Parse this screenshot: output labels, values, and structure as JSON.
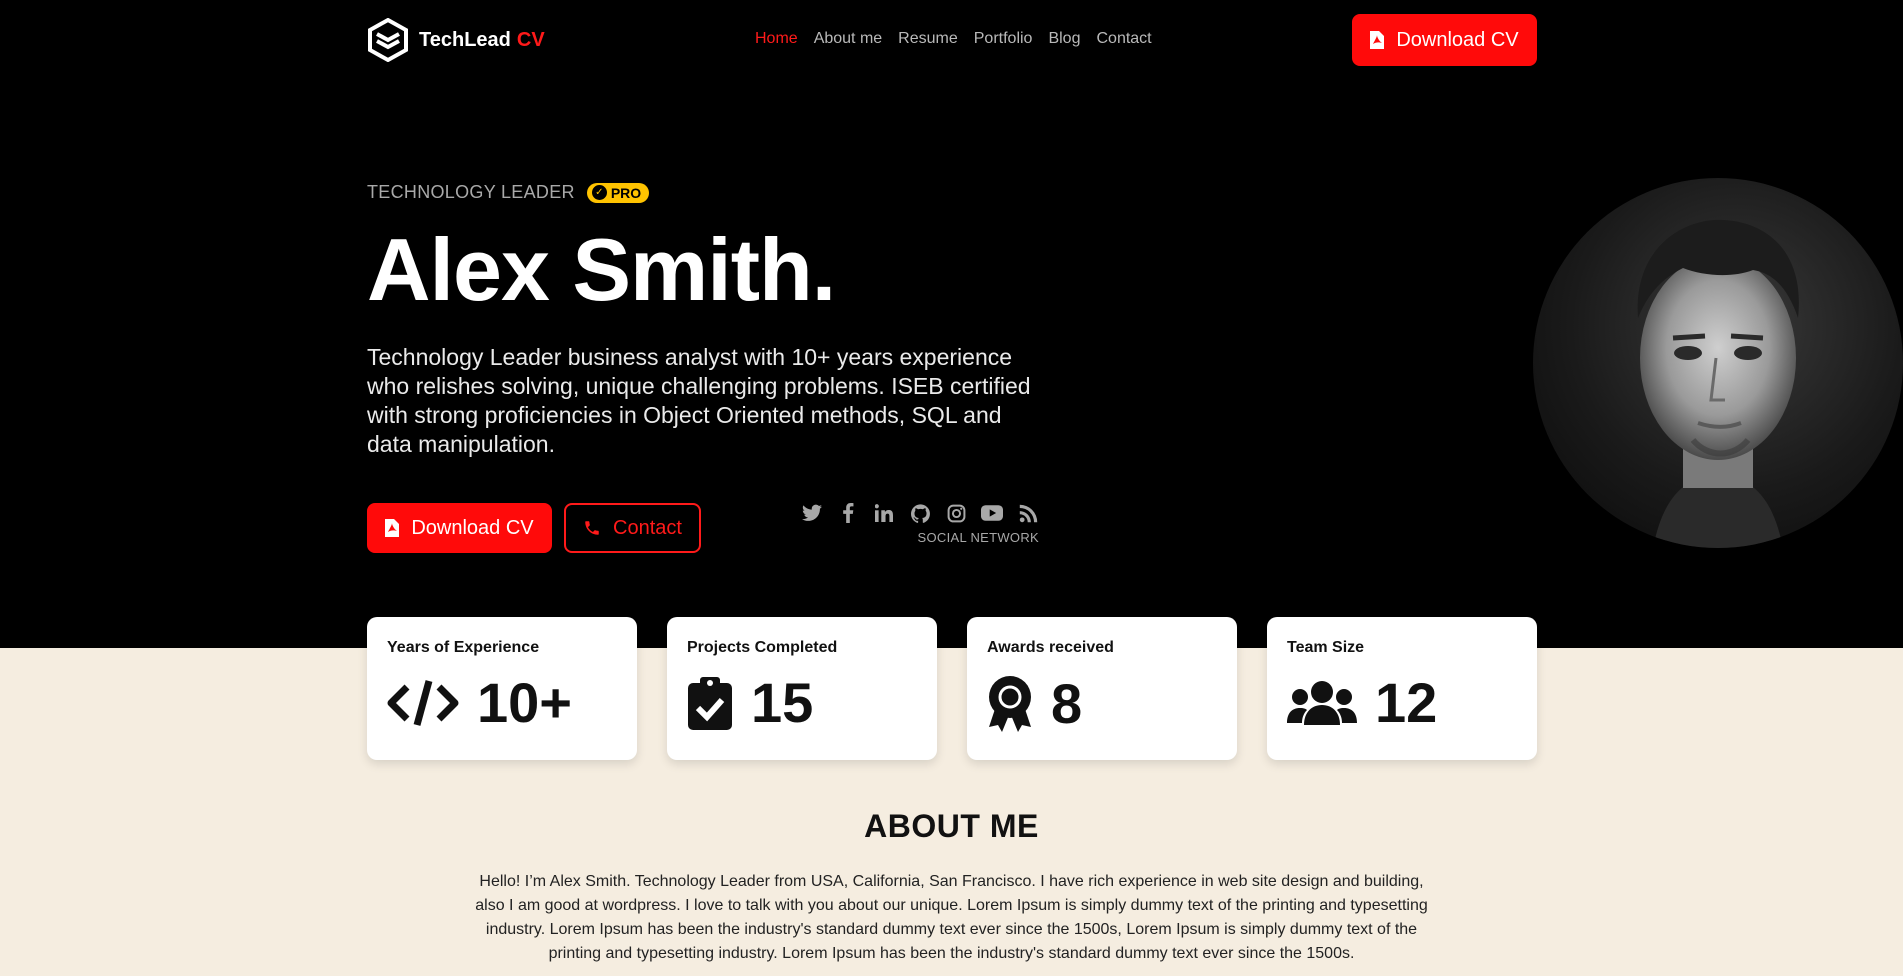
{
  "header": {
    "logo_text": "TechLead",
    "logo_accent": "CV",
    "nav": [
      {
        "label": "Home",
        "active": true
      },
      {
        "label": "About me",
        "active": false
      },
      {
        "label": "Resume",
        "active": false
      },
      {
        "label": "Portfolio",
        "active": false
      },
      {
        "label": "Blog",
        "active": false
      },
      {
        "label": "Contact",
        "active": false
      }
    ],
    "download_label": "Download CV"
  },
  "hero": {
    "eyebrow": "TECHNOLOGY LEADER",
    "badge": "PRO",
    "name": "Alex Smith.",
    "bio": "Technology Leader business analyst with 10+ years experience who relishes solving, unique challenging problems. ISEB certified with strong proficiencies in Object Oriented methods, SQL and data manipulation.",
    "download_label": "Download CV",
    "contact_label": "Contact",
    "social_label": "SOCIAL NETWORK",
    "social_icons": [
      "twitter-icon",
      "facebook-icon",
      "linkedin-icon",
      "github-icon",
      "instagram-icon",
      "youtube-icon",
      "rss-icon"
    ]
  },
  "stats": [
    {
      "title": "Years of Experience",
      "value": "10+",
      "icon": "code-icon"
    },
    {
      "title": "Projects Completed",
      "value": "15",
      "icon": "clipboard-check-icon"
    },
    {
      "title": "Awards received",
      "value": "8",
      "icon": "award-icon"
    },
    {
      "title": "Team Size",
      "value": "12",
      "icon": "users-icon"
    }
  ],
  "about": {
    "title": "ABOUT ME",
    "text": "Hello! I’m Alex Smith. Technology Leader from USA, California, San Francisco. I have rich experience in web site design and building, also I am good at wordpress. I love to talk with you about our unique. Lorem Ipsum is simply dummy text of the printing and typesetting industry. Lorem Ipsum has been the industry's standard dummy text ever since the 1500s, Lorem Ipsum is simply dummy text of the printing and typesetting industry. Lorem Ipsum has been the industry's standard dummy text ever since the 1500s."
  },
  "colors": {
    "accent": "#ff0a0a",
    "badge": "#ffc300",
    "hero_bg": "#000000",
    "page_bg": "#f5ede0"
  }
}
